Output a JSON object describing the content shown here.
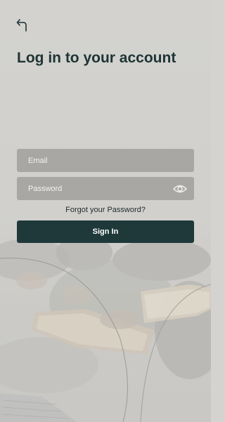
{
  "header": {
    "back_icon": "back-arrow-icon"
  },
  "page": {
    "title": "Log in to your account"
  },
  "form": {
    "email_placeholder": "Email",
    "email_value": "",
    "password_placeholder": "Password",
    "password_value": "",
    "eye_icon": "eye-icon",
    "forgot_label": "Forgot your Password?",
    "signin_label": "Sign In"
  },
  "colors": {
    "background": "#d4d3cf",
    "title": "#1e3335",
    "field_bg": "#a8a7a3",
    "button_bg": "#1f393b",
    "button_text": "#ffffff"
  }
}
